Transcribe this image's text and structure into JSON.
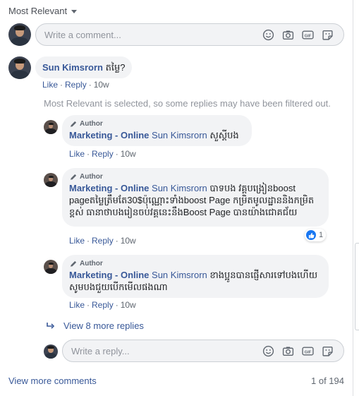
{
  "sort": {
    "label": "Most Relevant"
  },
  "composer": {
    "placeholder": "Write a comment..."
  },
  "comment": {
    "author": "Sun Kimsrorn",
    "text": "តម្លៃ?",
    "like": "Like",
    "reply": "Reply",
    "time": "10w"
  },
  "notice": "Most Relevant is selected, so some replies may have been filtered out.",
  "replies": [
    {
      "author_badge": "Author",
      "author": "Marketing - Online",
      "mention": "Sun Kimsrorn",
      "text": "សួស្តីបង",
      "like": "Like",
      "reply": "Reply",
      "time": "10w"
    },
    {
      "author_badge": "Author",
      "author": "Marketing - Online",
      "mention": "Sun Kimsrorn",
      "text": "បាទបង វគ្គបង្រៀនboost pageតម្លៃត្រឹមតែ30$ប៉ុណ្ណោះទាំងboost Page កម្រិតមូលដ្ឋាននិងកម្រិតខ្ពស់ ធានាថាបងរៀនចប់វគ្គនេះនឹងBoost Page បានយ៉ាងជោគជ័យ",
      "like": "Like",
      "reply": "Reply",
      "time": "10w",
      "reactions": "1"
    },
    {
      "author_badge": "Author",
      "author": "Marketing - Online",
      "mention": "Sun Kimsrorn",
      "text": "ខាងប្អូនបានផ្ញើសារទៅបងហើយ សូមបងជួយបើកមើលផងណា",
      "like": "Like",
      "reply": "Reply",
      "time": "10w"
    }
  ],
  "more_replies": "View 8 more replies",
  "reply_composer": {
    "placeholder": "Write a reply..."
  },
  "footer": {
    "view_more": "View more comments",
    "pager": "1 of 194"
  },
  "colors": {
    "link": "#385898",
    "like_badge": "#1877f2",
    "bubble": "#f2f3f5"
  }
}
